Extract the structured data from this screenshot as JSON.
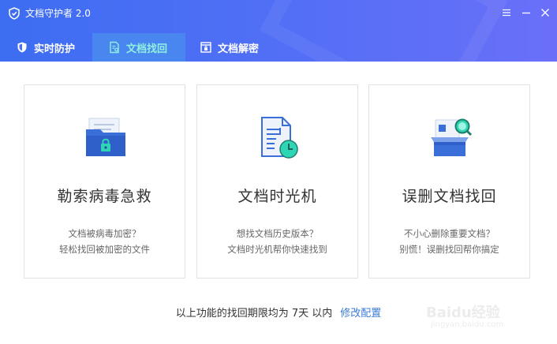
{
  "window": {
    "title": "文档守护者 2.0"
  },
  "tabs": [
    {
      "label": "实时防护",
      "icon": "shield-icon",
      "active": false
    },
    {
      "label": "文档找回",
      "icon": "document-search-icon",
      "active": true
    },
    {
      "label": "文档解密",
      "icon": "decrypt-icon",
      "active": false
    }
  ],
  "cards": [
    {
      "title": "勒索病毒急救",
      "desc1": "文档被病毒加密？",
      "desc2": "轻松找回被加密的文件",
      "icon": "locked-folder-icon"
    },
    {
      "title": "文档时光机",
      "desc1": "想找文档历史版本？",
      "desc2": "文档时光机帮你快速找到",
      "icon": "document-clock-icon"
    },
    {
      "title": "误删文档找回",
      "desc1": "不小心删除重要文档？",
      "desc2": "别慌！误删找回帮你搞定",
      "icon": "box-magnifier-icon"
    }
  ],
  "footer": {
    "text": "以上功能的找回期限均为 7天 以内",
    "link": "修改配置"
  },
  "watermark": {
    "line1": "Baidu经验",
    "line2": "jingyan.baidu.com"
  },
  "colors": {
    "header_start": "#3d6df2",
    "header_end": "#6a6ff8",
    "active_tab_bg": "#4a86f0",
    "active_tab_text": "#8ff0e0",
    "link": "#3a7bd5",
    "teal_accent": "#2fd6b5"
  }
}
